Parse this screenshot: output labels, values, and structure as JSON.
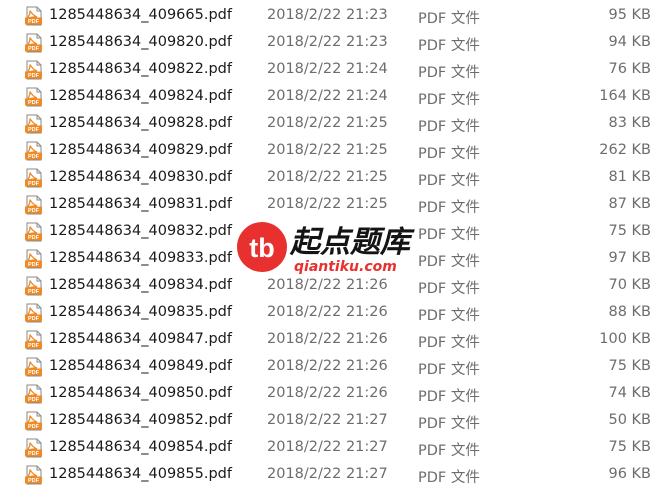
{
  "files": [
    {
      "name": "1285448634_409665.pdf",
      "modified": "2018/2/22 21:23",
      "type": "PDF 文件",
      "size": "95 KB"
    },
    {
      "name": "1285448634_409820.pdf",
      "modified": "2018/2/22 21:23",
      "type": "PDF 文件",
      "size": "94 KB"
    },
    {
      "name": "1285448634_409822.pdf",
      "modified": "2018/2/22 21:24",
      "type": "PDF 文件",
      "size": "76 KB"
    },
    {
      "name": "1285448634_409824.pdf",
      "modified": "2018/2/22 21:24",
      "type": "PDF 文件",
      "size": "164 KB"
    },
    {
      "name": "1285448634_409828.pdf",
      "modified": "2018/2/22 21:25",
      "type": "PDF 文件",
      "size": "83 KB"
    },
    {
      "name": "1285448634_409829.pdf",
      "modified": "2018/2/22 21:25",
      "type": "PDF 文件",
      "size": "262 KB"
    },
    {
      "name": "1285448634_409830.pdf",
      "modified": "2018/2/22 21:25",
      "type": "PDF 文件",
      "size": "81 KB"
    },
    {
      "name": "1285448634_409831.pdf",
      "modified": "2018/2/22 21:25",
      "type": "PDF 文件",
      "size": "87 KB"
    },
    {
      "name": "1285448634_409832.pdf",
      "modified": "",
      "type": "PDF 文件",
      "size": "75 KB"
    },
    {
      "name": "1285448634_409833.pdf",
      "modified": "",
      "type": "PDF 文件",
      "size": "97 KB"
    },
    {
      "name": "1285448634_409834.pdf",
      "modified": "2018/2/22 21:26",
      "type": "PDF 文件",
      "size": "70 KB"
    },
    {
      "name": "1285448634_409835.pdf",
      "modified": "2018/2/22 21:26",
      "type": "PDF 文件",
      "size": "88 KB"
    },
    {
      "name": "1285448634_409847.pdf",
      "modified": "2018/2/22 21:26",
      "type": "PDF 文件",
      "size": "100 KB"
    },
    {
      "name": "1285448634_409849.pdf",
      "modified": "2018/2/22 21:26",
      "type": "PDF 文件",
      "size": "75 KB"
    },
    {
      "name": "1285448634_409850.pdf",
      "modified": "2018/2/22 21:26",
      "type": "PDF 文件",
      "size": "74 KB"
    },
    {
      "name": "1285448634_409852.pdf",
      "modified": "2018/2/22 21:27",
      "type": "PDF 文件",
      "size": "50 KB"
    },
    {
      "name": "1285448634_409854.pdf",
      "modified": "2018/2/22 21:27",
      "type": "PDF 文件",
      "size": "75 KB"
    },
    {
      "name": "1285448634_409855.pdf",
      "modified": "2018/2/22 21:27",
      "type": "PDF 文件",
      "size": "96 KB"
    }
  ],
  "icons": {
    "file": "pdf-file-icon"
  },
  "colors": {
    "name_text": "#1a1a1a",
    "meta_text": "#6d6d6d",
    "pdf_icon_accent": "#f08a24",
    "watermark_red": "#e8312f"
  },
  "watermark": {
    "badge": "tb",
    "brand_cn": "起点题库",
    "brand_url": "qiantiku.com"
  }
}
